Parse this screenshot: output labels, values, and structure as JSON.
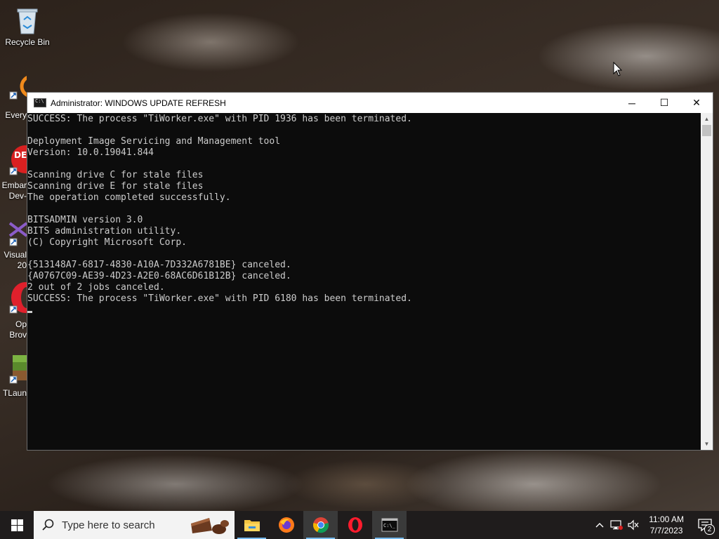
{
  "desktop": {
    "icons": [
      {
        "label": "Recycle Bin"
      },
      {
        "label": "Every"
      },
      {
        "label1": "Embar",
        "label2": "Dev-"
      },
      {
        "label1": "Visual",
        "label2": "20"
      },
      {
        "label1": "Op",
        "label2": "Brov"
      },
      {
        "label": "TLaun"
      }
    ]
  },
  "window": {
    "title": "Administrator:  WINDOWS UPDATE REFRESH",
    "minimize_glyph": "─",
    "maximize_glyph": "☐",
    "close_glyph": "✕",
    "console_lines": [
      "SUCCESS: The process \"TiWorker.exe\" with PID 1936 has been terminated.",
      "",
      "Deployment Image Servicing and Management tool",
      "Version: 10.0.19041.844",
      "",
      "Scanning drive C for stale files",
      "Scanning drive E for stale files",
      "The operation completed successfully.",
      "",
      "BITSADMIN version 3.0",
      "BITS administration utility.",
      "(C) Copyright Microsoft Corp.",
      "",
      "{513148A7-6817-4830-A10A-7D332A6781BE} canceled.",
      "{A0767C09-AE39-4D23-A2E0-68AC6D61B12B} canceled.",
      "2 out of 2 jobs canceled.",
      "SUCCESS: The process \"TiWorker.exe\" with PID 6180 has been terminated."
    ]
  },
  "taskbar": {
    "search_placeholder": "Type here to search",
    "apps": [
      "file-explorer",
      "firefox",
      "chrome",
      "opera",
      "command-prompt"
    ],
    "time": "11:00 AM",
    "date": "7/7/2023",
    "notification_count": "2",
    "colors": {
      "accent": "#76b9ed",
      "taskbar": "#1f1c1c"
    }
  }
}
